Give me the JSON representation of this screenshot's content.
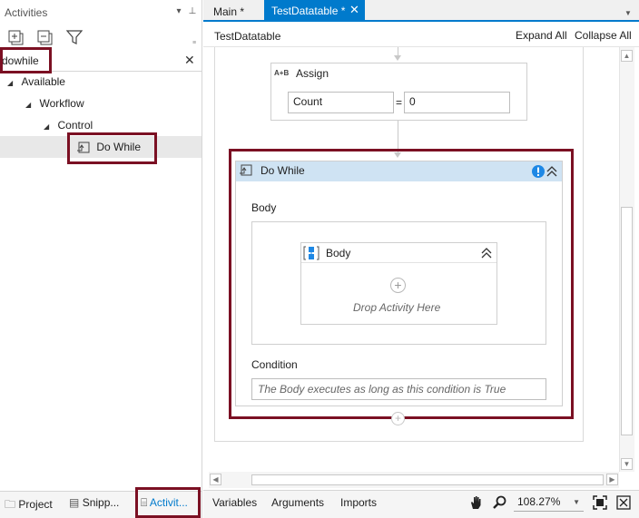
{
  "activities_panel": {
    "title": "Activities",
    "search": {
      "value": "dowhile",
      "placeholder": ""
    },
    "tree": [
      {
        "label": "Available"
      },
      {
        "label": "Workflow"
      },
      {
        "label": "Control"
      },
      {
        "label": "Do While"
      }
    ],
    "bottom_tabs": [
      {
        "label": "Project"
      },
      {
        "label": "Snipp..."
      },
      {
        "label": "Activit..."
      }
    ]
  },
  "document_tabs": [
    {
      "label": "Main *"
    },
    {
      "label": "TestDatatable *"
    }
  ],
  "designer": {
    "breadcrumb": "TestDatatable",
    "expand_all": "Expand All",
    "collapse_all": "Collapse All",
    "assign": {
      "title": "Assign",
      "icon_text": "A+B",
      "to": "Count",
      "operator": "=",
      "value": "0"
    },
    "do_while": {
      "title": "Do While",
      "body_label": "Body",
      "sequence_title": "Body",
      "drop_hint": "Drop Activity Here",
      "condition_label": "Condition",
      "condition_placeholder": "The Body executes as long as this condition is True"
    }
  },
  "bottom_bar": {
    "variables": "Variables",
    "arguments": "Arguments",
    "imports": "Imports",
    "zoom": "108.27%"
  },
  "colors": {
    "accent": "#007acc",
    "highlight": "#7b1023",
    "activity_header": "#cfe3f3",
    "warning_icon": "#1e88e5"
  }
}
